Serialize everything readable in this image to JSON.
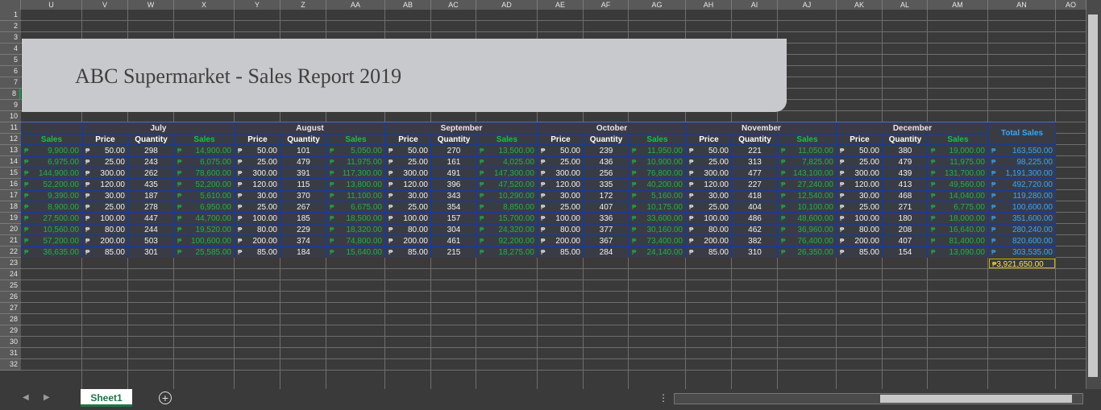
{
  "spreadsheet": {
    "columns": [
      "U",
      "V",
      "W",
      "X",
      "Y",
      "Z",
      "AA",
      "AB",
      "AC",
      "AD",
      "AE",
      "AF",
      "AG",
      "AH",
      "AI",
      "AJ",
      "AK",
      "AL",
      "AM",
      "AN",
      "AO"
    ],
    "rows": [
      "1",
      "2",
      "3",
      "4",
      "5",
      "6",
      "7",
      "8",
      "9",
      "10",
      "11",
      "12",
      "13",
      "14",
      "15",
      "16",
      "17",
      "18",
      "19",
      "20",
      "21",
      "22",
      "23",
      "24",
      "25",
      "26",
      "27",
      "28",
      "29",
      "30",
      "31",
      "32"
    ],
    "title": "ABC Supermarket - Sales Report 2019",
    "currency_symbol": "₱",
    "header_sales": "Sales",
    "header_price": "Price",
    "header_quantity": "Quantity",
    "total_sales_label": "Total Sales",
    "first_sales_column": [
      "9,900.00",
      "6,975.00",
      "144,900.00",
      "52,200.00",
      "9,390.00",
      "8,900.00",
      "27,500.00",
      "10,560.00",
      "57,200.00",
      "36,635.00"
    ],
    "months": [
      {
        "name": "July",
        "price": [
          "50.00",
          "25.00",
          "300.00",
          "120.00",
          "30.00",
          "25.00",
          "100.00",
          "80.00",
          "200.00",
          "85.00"
        ],
        "qty": [
          "298",
          "243",
          "262",
          "435",
          "187",
          "278",
          "447",
          "244",
          "503",
          "301"
        ],
        "sales": [
          "14,900.00",
          "6,075.00",
          "78,600.00",
          "52,200.00",
          "5,610.00",
          "6,950.00",
          "44,700.00",
          "19,520.00",
          "100,600.00",
          "25,585.00"
        ]
      },
      {
        "name": "August",
        "price": [
          "50.00",
          "25.00",
          "300.00",
          "120.00",
          "30.00",
          "25.00",
          "100.00",
          "80.00",
          "200.00",
          "85.00"
        ],
        "qty": [
          "101",
          "479",
          "391",
          "115",
          "370",
          "267",
          "185",
          "229",
          "374",
          "184"
        ],
        "sales": [
          "5,050.00",
          "11,975.00",
          "117,300.00",
          "13,800.00",
          "11,100.00",
          "6,675.00",
          "18,500.00",
          "18,320.00",
          "74,800.00",
          "15,640.00"
        ]
      },
      {
        "name": "September",
        "price": [
          "50.00",
          "25.00",
          "300.00",
          "120.00",
          "30.00",
          "25.00",
          "100.00",
          "80.00",
          "200.00",
          "85.00"
        ],
        "qty": [
          "270",
          "161",
          "491",
          "396",
          "343",
          "354",
          "157",
          "304",
          "461",
          "215"
        ],
        "sales": [
          "13,500.00",
          "4,025.00",
          "147,300.00",
          "47,520.00",
          "10,290.00",
          "8,850.00",
          "15,700.00",
          "24,320.00",
          "92,200.00",
          "18,275.00"
        ]
      },
      {
        "name": "October",
        "price": [
          "50.00",
          "25.00",
          "300.00",
          "120.00",
          "30.00",
          "25.00",
          "100.00",
          "80.00",
          "200.00",
          "85.00"
        ],
        "qty": [
          "239",
          "436",
          "256",
          "335",
          "172",
          "407",
          "336",
          "377",
          "367",
          "284"
        ],
        "sales": [
          "11,950.00",
          "10,900.00",
          "76,800.00",
          "40,200.00",
          "5,160.00",
          "10,175.00",
          "33,600.00",
          "30,160.00",
          "73,400.00",
          "24,140.00"
        ]
      },
      {
        "name": "November",
        "price": [
          "50.00",
          "25.00",
          "300.00",
          "120.00",
          "30.00",
          "25.00",
          "100.00",
          "80.00",
          "200.00",
          "85.00"
        ],
        "qty": [
          "221",
          "313",
          "477",
          "227",
          "418",
          "404",
          "486",
          "462",
          "382",
          "310"
        ],
        "sales": [
          "11,050.00",
          "7,825.00",
          "143,100.00",
          "27,240.00",
          "12,540.00",
          "10,100.00",
          "48,600.00",
          "36,960.00",
          "76,400.00",
          "26,350.00"
        ]
      },
      {
        "name": "December",
        "price": [
          "50.00",
          "25.00",
          "300.00",
          "120.00",
          "30.00",
          "25.00",
          "100.00",
          "80.00",
          "200.00",
          "85.00"
        ],
        "qty": [
          "380",
          "479",
          "439",
          "413",
          "468",
          "271",
          "180",
          "208",
          "407",
          "154"
        ],
        "sales": [
          "19,000.00",
          "11,975.00",
          "131,700.00",
          "49,560.00",
          "14,040.00",
          "6,775.00",
          "18,000.00",
          "16,640.00",
          "81,400.00",
          "13,090.00"
        ]
      }
    ],
    "total_sales": [
      "163,550.00",
      "98,225.00",
      "1,191,300.00",
      "492,720.00",
      "119,280.00",
      "100,600.00",
      "351,600.00",
      "280,240.00",
      "820,600.00",
      "303,535.00"
    ],
    "grand_total": "3,921,650.00"
  },
  "sheet_tabs": {
    "active": "Sheet1",
    "add_icon": "plus-circle-icon"
  },
  "colors": {
    "sales_green": "#1fb24a",
    "total_blue": "#35a6ff",
    "grand_yellow": "#ffe14a",
    "sheet_green": "#217346"
  }
}
